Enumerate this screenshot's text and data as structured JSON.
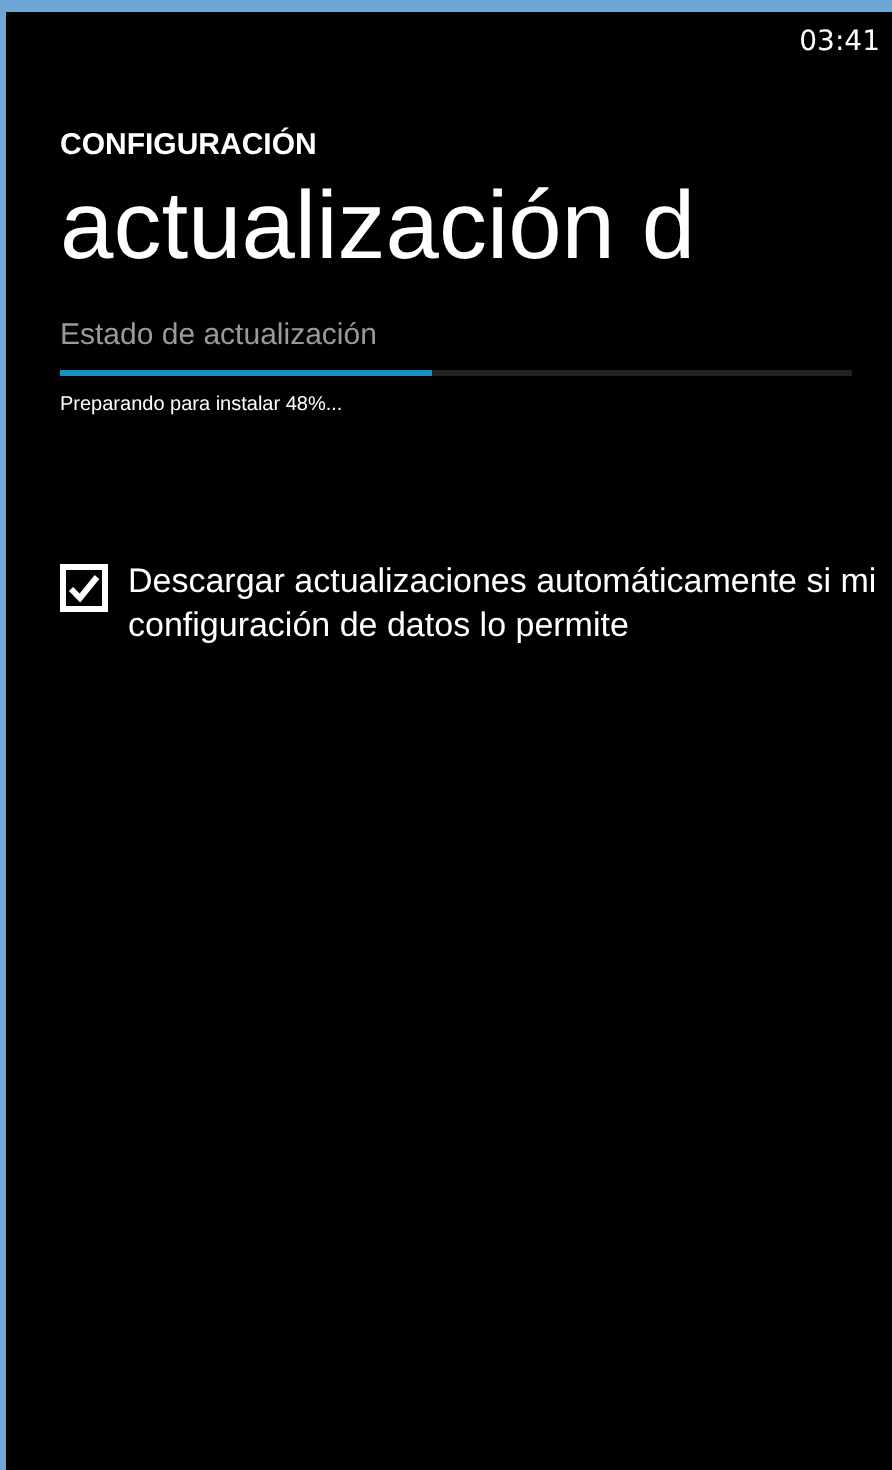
{
  "status_bar": {
    "time": "03:41"
  },
  "header": {
    "app_title": "CONFIGURACIÓN",
    "page_title": "actualización d"
  },
  "update_status": {
    "label": "Estado de actualización",
    "level": 0.47,
    "message": "Preparando para instalar 48%..."
  },
  "auto_download": {
    "checked": true,
    "label": "Descargar actualizaciones automáticamente si mi configuración de datos lo permite"
  }
}
